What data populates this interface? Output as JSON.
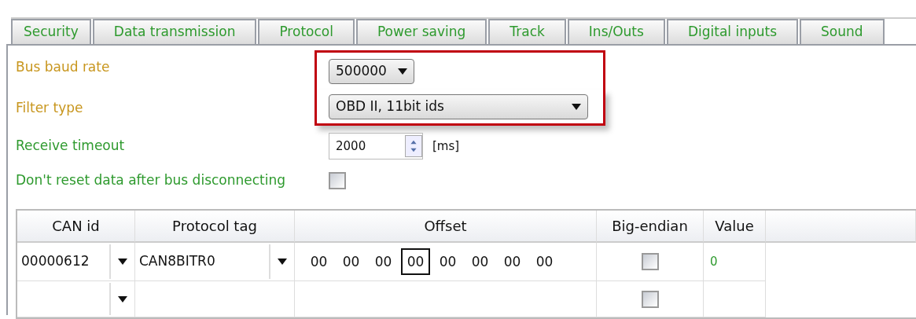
{
  "tabs": [
    {
      "label": "Security",
      "selected": false
    },
    {
      "label": "Data transmission",
      "selected": false
    },
    {
      "label": "Protocol",
      "selected": false
    },
    {
      "label": "Power saving",
      "selected": false
    },
    {
      "label": "Track",
      "selected": false
    },
    {
      "label": "Ins/Outs",
      "selected": false
    },
    {
      "label": "Digital inputs",
      "selected": false
    },
    {
      "label": "Sound",
      "selected": false
    }
  ],
  "settings": [
    {
      "kind": "select",
      "label": "Bus baud rate",
      "color": "#c8961e",
      "value": "500000",
      "highlighted": true
    },
    {
      "kind": "select",
      "label": "Filter type",
      "color": "#c8961e",
      "value": "OBD II, 11bit ids",
      "highlighted": true
    },
    {
      "kind": "spin",
      "label": "Receive timeout",
      "color": "#2e9a2e",
      "value": "2000",
      "unit": "[ms]",
      "highlighted": false
    },
    {
      "kind": "checkbox",
      "label": "Don't reset data after bus disconnecting",
      "color": "#2e9a2e",
      "checked": false,
      "highlighted": false
    }
  ],
  "table": {
    "columns": [
      "CAN id",
      "Protocol tag",
      "Offset",
      "Big-endian",
      "Value"
    ],
    "rows": [
      {
        "can_id": "00000612",
        "protocol_tag": "CAN8BITR0",
        "offset": [
          {
            "text": "00",
            "selected": false
          },
          {
            "text": "00",
            "selected": false
          },
          {
            "text": "00",
            "selected": false
          },
          {
            "text": "00",
            "selected": true
          },
          {
            "text": "00",
            "selected": false
          },
          {
            "text": "00",
            "selected": false
          },
          {
            "text": "00",
            "selected": false
          },
          {
            "text": "00",
            "selected": false
          }
        ],
        "big_endian": false,
        "value": "0"
      },
      {
        "big_endian": false
      }
    ]
  }
}
